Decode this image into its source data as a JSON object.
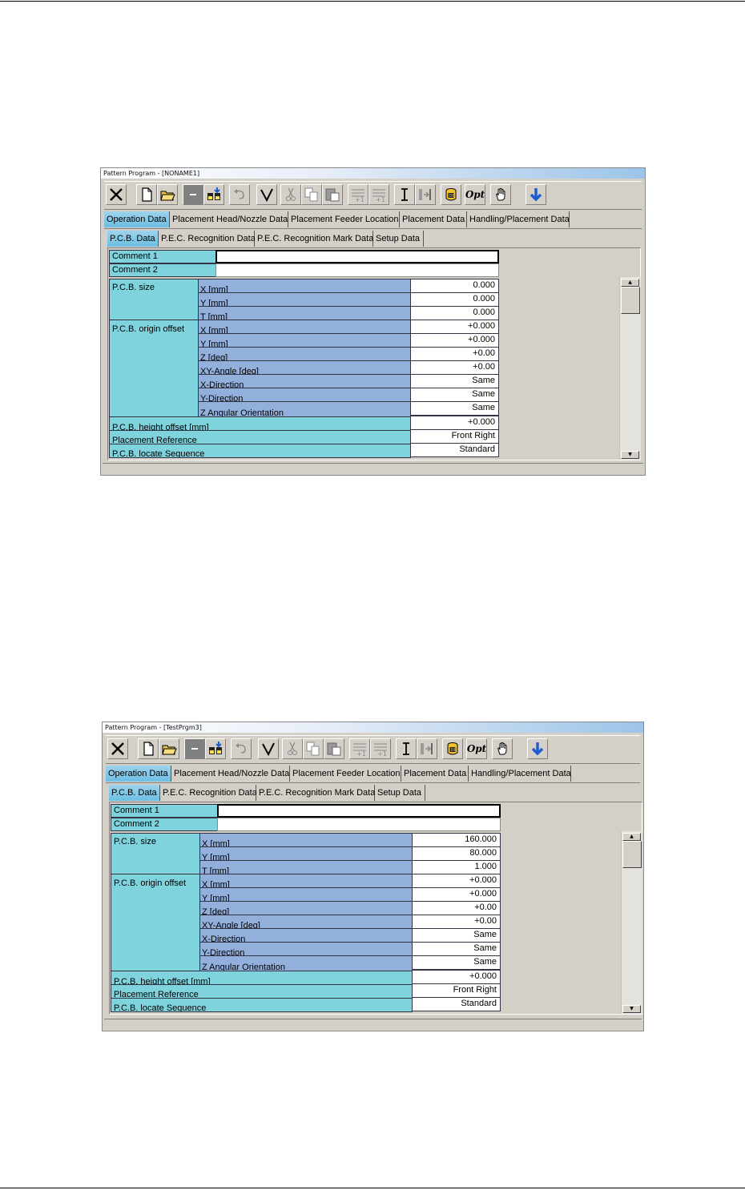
{
  "colors": {
    "teal_label": "#7fd3dd",
    "blue_label": "#93b0dc",
    "active_tab": "#6cbfe3",
    "window_bg": "#d4d0c8"
  },
  "toolbar_icons": [
    "close-icon",
    "new-file-icon",
    "open-folder-icon",
    "minimize-icon",
    "save-icon",
    "undo-icon",
    "check-icon",
    "cut-icon",
    "copy-icon",
    "paste-icon",
    "insert-plus-icon",
    "insert-plus-icon-2",
    "text-cursor-icon",
    "goto-icon",
    "database-icon",
    "optimize-icon",
    "hand-icon",
    "download-arrow-icon"
  ],
  "toolbar_opt_label": "Opt",
  "main_tabs": [
    "Operation Data",
    "Placement Head/Nozzle Data",
    "Placement Feeder Location",
    "Placement Data",
    "Handling/Placement Data"
  ],
  "sub_tabs": [
    "P.C.B. Data",
    "P.E.C. Recognition Data",
    "P.E.C. Recognition Mark Data",
    "Setup Data"
  ],
  "labels": {
    "comment1": "Comment 1",
    "comment2": "Comment 2",
    "pcb_size": "P.C.B. size",
    "pcb_origin_offset": "P.C.B. origin offset",
    "x_mm": "X [mm]",
    "y_mm": "Y [mm]",
    "t_mm": "T [mm]",
    "z_deg": "Z [deg]",
    "xy_angle": "XY-Angle [deg]",
    "x_direction": "X-Direction",
    "y_direction": "Y-Direction",
    "z_angular": "Z Angular Orientation",
    "pcb_height_offset": "P.C.B. height offset [mm]",
    "placement_reference": "Placement Reference",
    "pcb_locate_sequence": "P.C.B. locate Sequence"
  },
  "windows": [
    {
      "title": "Pattern Program - [NONAME1]",
      "values": {
        "size_x": "0.000",
        "size_y": "0.000",
        "size_t": "0.000",
        "off_x": "+0.000",
        "off_y": "+0.000",
        "off_z": "+0.00",
        "off_xy": "+0.00",
        "x_dir": "Same",
        "y_dir": "Same",
        "z_orient": "Same",
        "height_offset": "+0.000",
        "placement_ref": "Front Right",
        "locate_seq": "Standard"
      }
    },
    {
      "title": "Pattern Program - [TestPrgm3]",
      "values": {
        "size_x": "160.000",
        "size_y": "80.000",
        "size_t": "1.000",
        "off_x": "+0.000",
        "off_y": "+0.000",
        "off_z": "+0.00",
        "off_xy": "+0.00",
        "x_dir": "Same",
        "y_dir": "Same",
        "z_orient": "Same",
        "height_offset": "+0.000",
        "placement_ref": "Front Right",
        "locate_seq": "Standard"
      }
    }
  ]
}
